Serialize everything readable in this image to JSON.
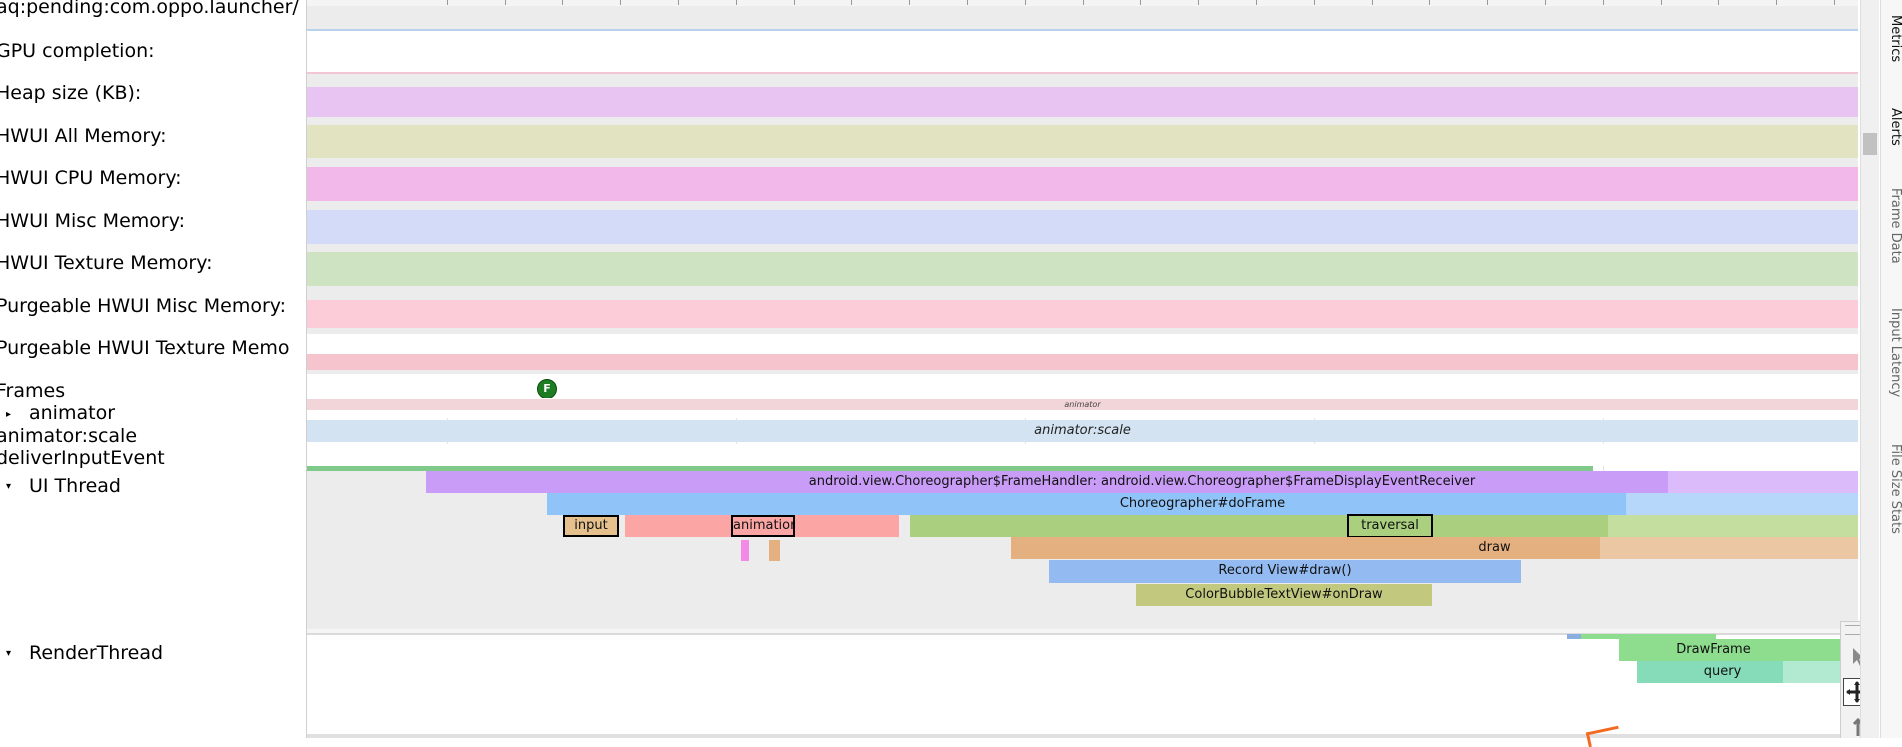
{
  "labels": {
    "pending": "aq:pending:com.oppo.launcher/",
    "gpu_completion": "GPU completion:",
    "heap_size": "Heap size (KB):",
    "hwui_all": "HWUI All Memory:",
    "hwui_cpu": "HWUI CPU Memory:",
    "hwui_misc": "HWUI Misc Memory:",
    "hwui_texture": "HWUI Texture Memory:",
    "purgeable_misc": "Purgeable HWUI Misc Memory:",
    "purgeable_texture": "Purgeable HWUI Texture Memo",
    "frames": "Frames",
    "animator": "animator",
    "animator_scale": "animator:scale",
    "deliver_input": "deliverInputEvent",
    "ui_thread": "UI Thread",
    "render_thread": "RenderThread"
  },
  "frame_marker": "F",
  "slices": {
    "animator_small": "animator",
    "animator_scale": "animator:scale",
    "frame_handler": "android.view.Choreographer$FrameHandler: android.view.Choreographer$FrameDisplayEventReceiver",
    "do_frame": "Choreographer#doFrame",
    "input": "input",
    "animation": "animation",
    "traversal": "traversal",
    "draw": "draw",
    "record_view": "Record View#draw()",
    "color_bubble": "ColorBubbleTextView#onDraw",
    "draw_frame": "DrawFrame",
    "query": "query"
  },
  "side_tabs": [
    "Metrics",
    "Alerts",
    "Frame Data",
    "Input Latency",
    "File Size Stats"
  ],
  "colors": {
    "heap": "#e8c4f2",
    "hwui_all": "#e2e3c1",
    "hwui_cpu": "#f3b8ea",
    "hwui_misc": "#d3dbf8",
    "hwui_texture": "#cde3c1",
    "purgeable_misc": "#fccdd8",
    "purgeable_texture": "#f6c4cc",
    "frame_handler": "#c99cf7",
    "do_frame": "#90c3f7",
    "input": "#e6c08d",
    "animation_bar": "#fba5a5",
    "traversal_bar": "#a9cf7f",
    "draw": "#e4b07f",
    "record_view": "#93bbf2",
    "color_bubble": "#c2c97f",
    "draw_frame": "#8edc8e",
    "query": "#86dcb9"
  },
  "icons": [
    "pointer-tool-icon",
    "pan-tool-icon",
    "zoom-tool-icon",
    "triangle-right-icon",
    "triangle-down-icon"
  ]
}
